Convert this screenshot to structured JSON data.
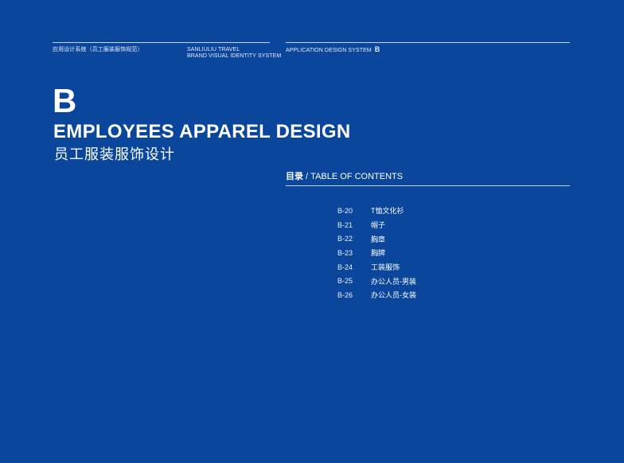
{
  "header": {
    "left_label": "应用设计系统（员工服装服饰规范）",
    "brand_line1": "SANLIULIU TRAVEL",
    "brand_line2": "BRAND VISUAL IDENTITY SYSTEM",
    "system_label": "APPLICATION DESIGN SYSTEM",
    "system_letter": "B"
  },
  "section": {
    "letter": "B",
    "title_en": "EMPLOYEES APPAREL DESIGN",
    "title_cn": "员工服装服饰设计"
  },
  "toc": {
    "heading_cn": "目录",
    "heading_sep": " / ",
    "heading_en": "TABLE OF CONTENTS",
    "items": [
      {
        "code": "B-20",
        "title": "T恤文化衫"
      },
      {
        "code": "B-21",
        "title": "帽子"
      },
      {
        "code": "B-22",
        "title": "胸章"
      },
      {
        "code": "B-23",
        "title": "胸牌"
      },
      {
        "code": "B-24",
        "title": "工装服饰"
      },
      {
        "code": "B-25",
        "title": "办公人员-男装"
      },
      {
        "code": "B-26",
        "title": "办公人员-女装"
      }
    ]
  },
  "colors": {
    "background": "#0a469c",
    "text": "#ffffff"
  }
}
